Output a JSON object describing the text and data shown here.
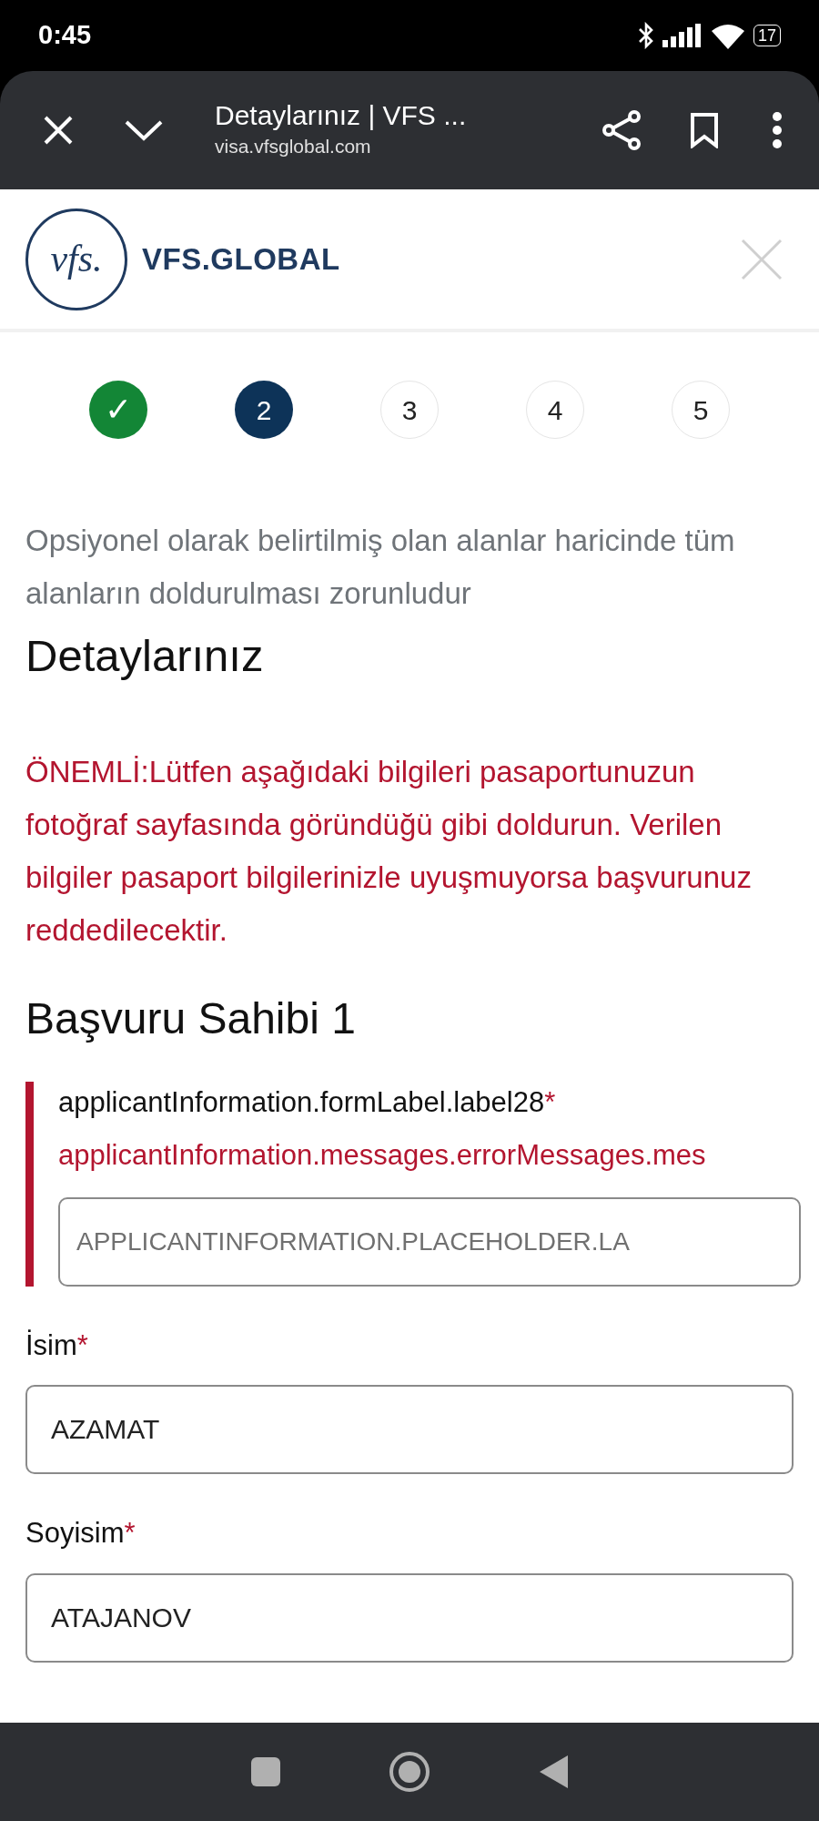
{
  "status_bar": {
    "time": "0:45",
    "battery": "17"
  },
  "browser": {
    "title": "Detaylarınız | VFS ...",
    "url": "visa.vfsglobal.com"
  },
  "header": {
    "logo_mark": "vfs.",
    "logo_text": "VFS.GLOBAL"
  },
  "steps": [
    {
      "label": "✓",
      "done": true,
      "selected": false
    },
    {
      "label": "2",
      "done": false,
      "selected": true
    },
    {
      "label": "3",
      "done": false,
      "selected": false
    },
    {
      "label": "4",
      "done": false,
      "selected": false
    },
    {
      "label": "5",
      "done": false,
      "selected": false
    }
  ],
  "instructions": "Opsiyonel olarak belirtilmiş olan alanlar haricinde tüm alanların doldurulması zorunludur",
  "heading": "Detaylarınız",
  "notice": "ÖNEMLİ:Lütfen aşağıdaki bilgileri pasaportunuzun fotoğraf sayfasında göründüğü gibi doldurun. Verilen bilgiler pasaport bilgilerinizle uyuşmuyorsa başvurunuz reddedilecektir.",
  "applicant_heading": "Başvuru Sahibi 1",
  "fields": [
    {
      "label": "applicantInformation.formLabel.label28",
      "required": "*",
      "error": "applicantInformation.messages.errorMessages.mes",
      "placeholder": "APPLICANTINFORMATION.PLACEHOLDER.LA",
      "invalid": true
    },
    {
      "label": "İsim",
      "required": "*",
      "value": "AZAMAT",
      "invalid": false
    },
    {
      "label": "Soyisim",
      "required": "*",
      "value": "ATAJANOV",
      "invalid": false
    }
  ]
}
